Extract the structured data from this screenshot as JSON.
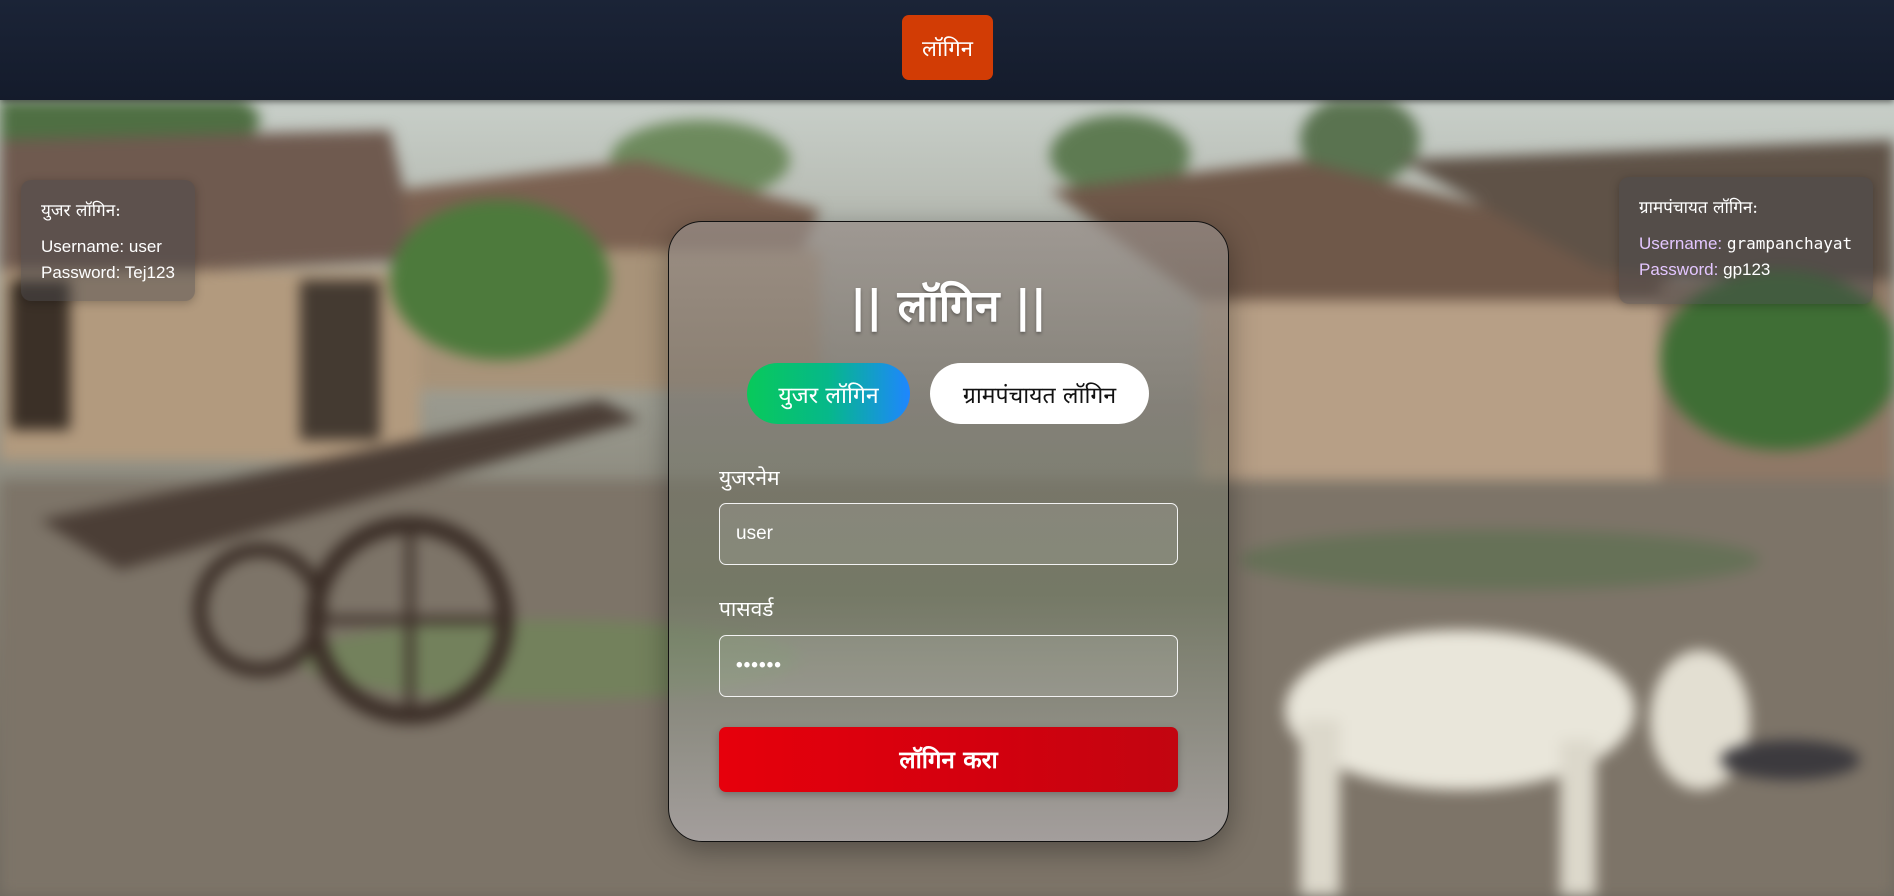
{
  "topbar": {
    "login_label": "लॉगिन"
  },
  "info_user": {
    "title": "युजर लॉगिन:",
    "username_key": "Username:",
    "username_value": "user",
    "password_key": "Password:",
    "password_value": "Tej123"
  },
  "info_gp": {
    "title": "ग्रामपंचायत लॉगिन:",
    "username_key": "Username:",
    "username_value": "grampanchayat",
    "password_key": "Password:",
    "password_value": "gp123"
  },
  "card": {
    "title": "|| लॉगिन ||",
    "tabs": [
      {
        "label": "युजर लॉगिन",
        "active": true
      },
      {
        "label": "ग्रामपंचायत लॉगिन",
        "active": false
      }
    ],
    "username_label": "युजरनेम",
    "username_value": "user",
    "password_label": "पासवर्ड",
    "password_value": "••••••",
    "submit_label": "लॉगिन करा"
  },
  "colors": {
    "topbar_button": "#d23c05",
    "submit": "#e6000c",
    "tab_gradient": [
      "#08c95a",
      "#1e86ff"
    ]
  }
}
